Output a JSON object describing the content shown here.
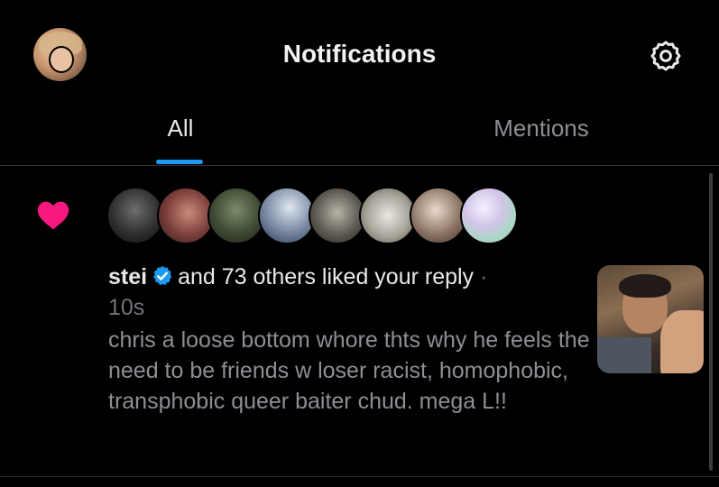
{
  "header": {
    "title": "Notifications",
    "avatar_icon": "profile-avatar",
    "settings_icon": "gear-icon"
  },
  "tabs": [
    {
      "label": "All",
      "active": true
    },
    {
      "label": "Mentions",
      "active": false
    }
  ],
  "notification": {
    "type_icon": "heart-icon",
    "username": "stei",
    "verified": true,
    "action_text": "and 73 others liked your reply",
    "separator": "·",
    "timestamp": "10s",
    "reply_text": "chris a loose bottom whore thts why he feels the need to be friends w loser racist, homophobic, transphobic queer baiter chud. mega L!!",
    "liker_avatar_count": 8
  },
  "colors": {
    "background": "#000000",
    "accent": "#1d9bf0",
    "like": "#f91880",
    "muted_text": "#71767b"
  }
}
